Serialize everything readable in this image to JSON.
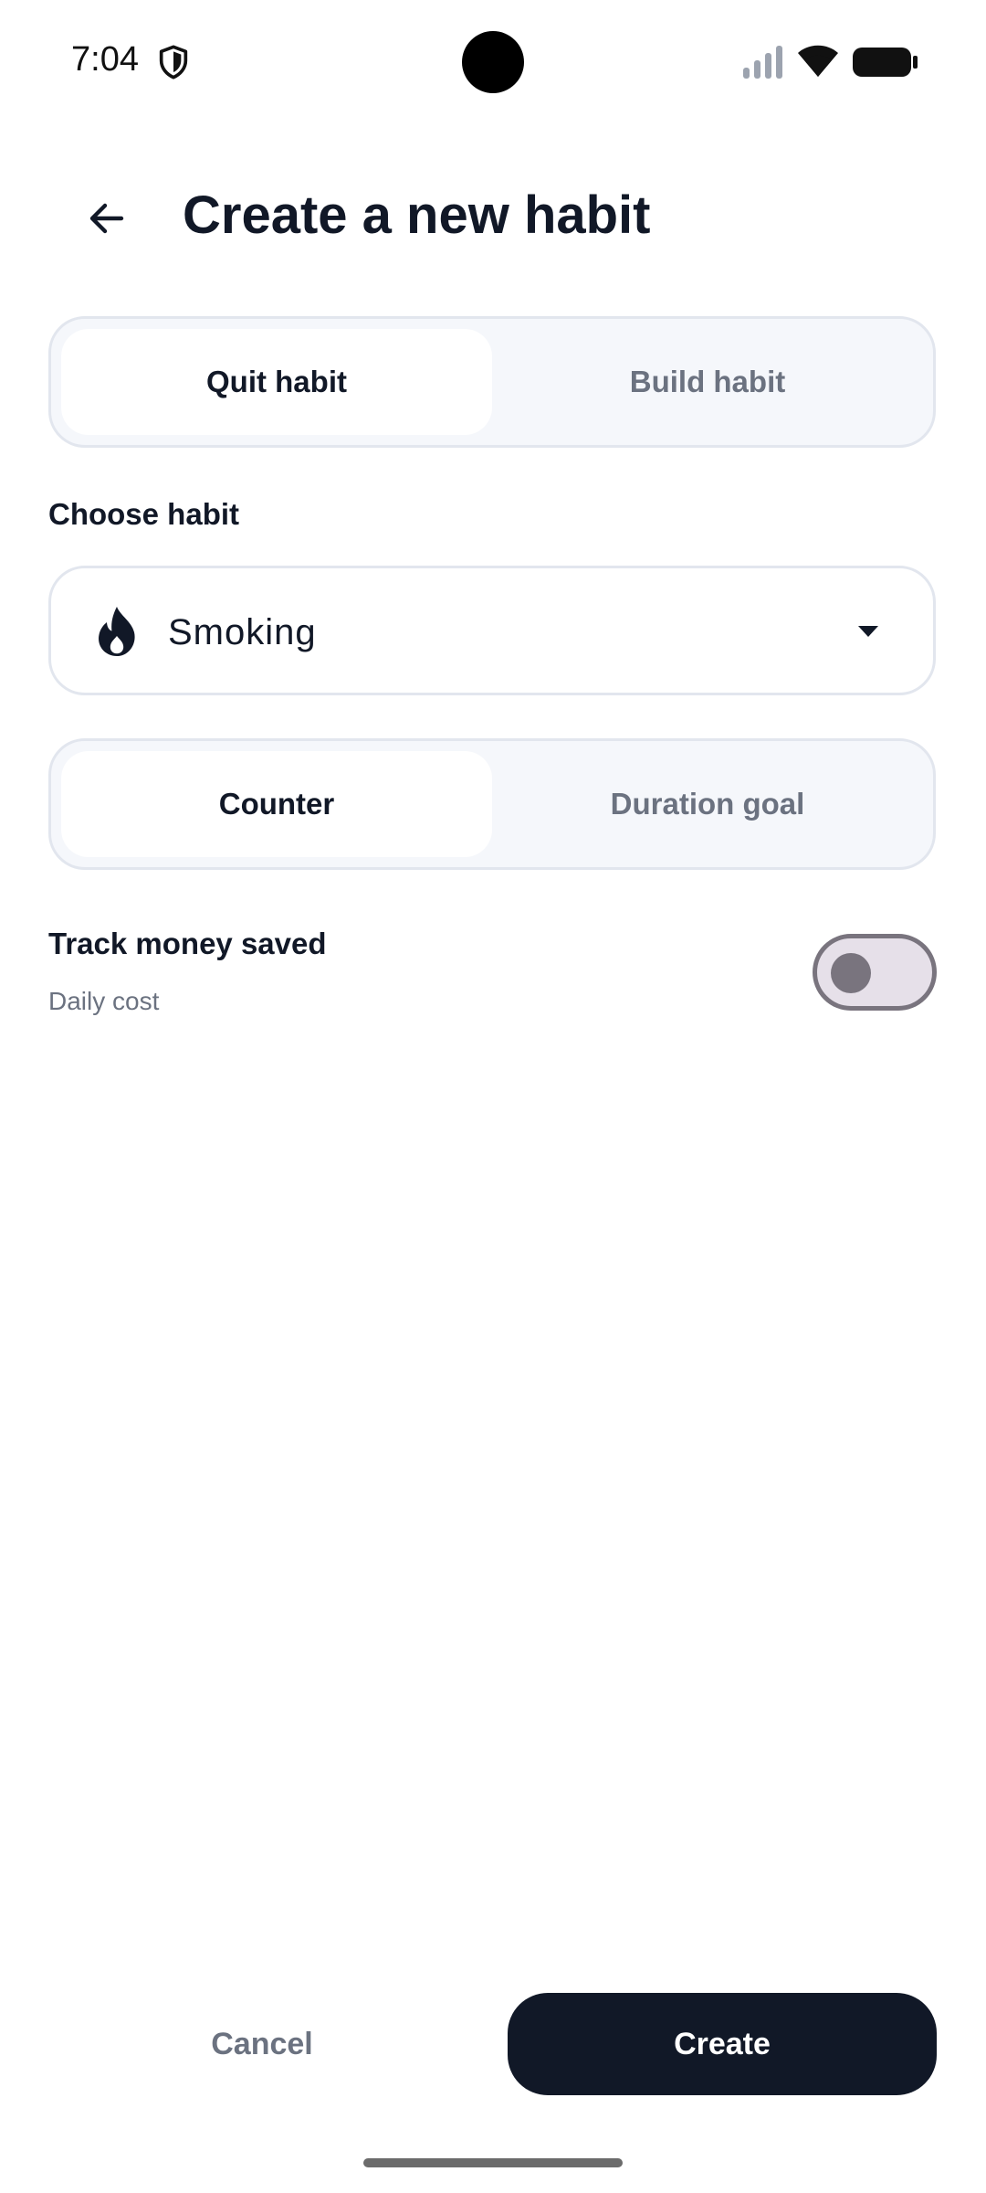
{
  "status_bar": {
    "time": "7:04",
    "icons": [
      "shield-icon",
      "cell-signal-icon",
      "wifi-icon",
      "battery-icon"
    ]
  },
  "header": {
    "back_icon": "arrow-left-icon",
    "title": "Create a new habit"
  },
  "habit_type": {
    "options": [
      {
        "label": "Quit habit",
        "selected": true
      },
      {
        "label": "Build habit",
        "selected": false
      }
    ]
  },
  "choose_habit": {
    "label": "Choose habit",
    "icon": "flame-icon",
    "value": "Smoking",
    "arrow_icon": "caret-down-icon"
  },
  "tracking_mode": {
    "options": [
      {
        "label": "Counter",
        "selected": true
      },
      {
        "label": "Duration goal",
        "selected": false
      }
    ]
  },
  "money_saved": {
    "label": "Track money saved",
    "sublabel": "Daily cost",
    "enabled": false
  },
  "footer": {
    "cancel_label": "Cancel",
    "create_label": "Create"
  },
  "colors": {
    "primary": "#111827",
    "muted_text": "#6b7280",
    "segment_bg": "#f5f7fb",
    "border": "#e2e6ee",
    "toggle_off_track": "#e6e0e9",
    "toggle_off_outline": "#79747e"
  }
}
